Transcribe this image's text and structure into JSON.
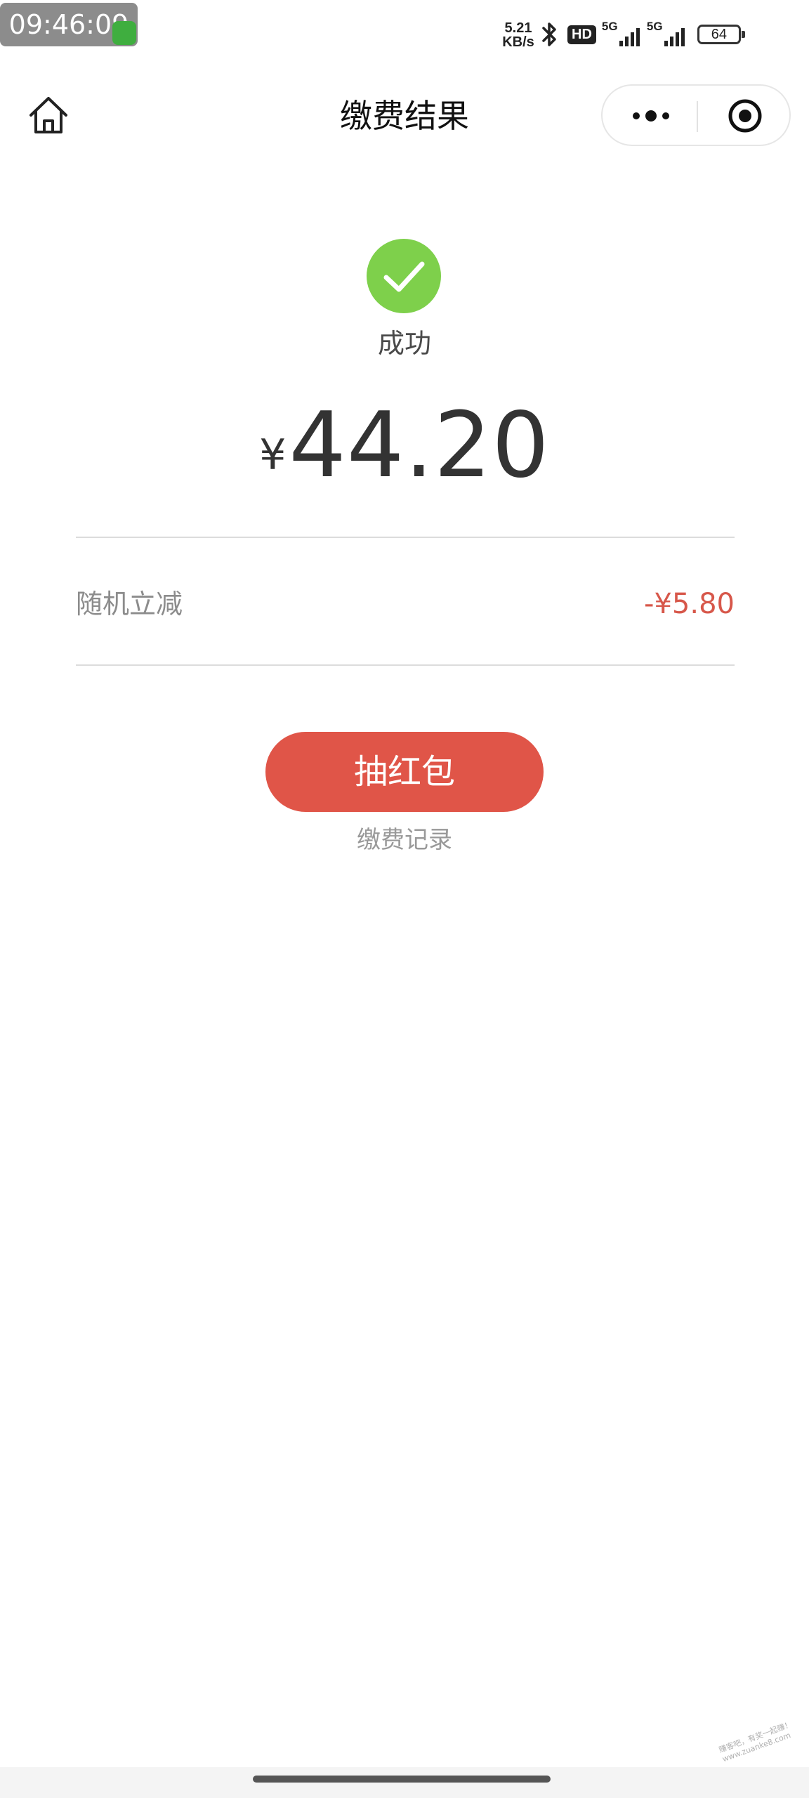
{
  "status_bar": {
    "time": "09:46:09",
    "net_speed_value": "5.21",
    "net_speed_unit": "KB/s",
    "hd_label": "HD",
    "signal_1_label": "5G",
    "signal_2_label": "5G",
    "battery": "64"
  },
  "nav": {
    "title": "缴费结果"
  },
  "result": {
    "status": "成功",
    "currency": "¥",
    "amount": "44.20",
    "discount_label": "随机立减",
    "discount_value": "-¥5.80",
    "primary_button": "抽红包",
    "records_link": "缴费记录"
  },
  "watermark": {
    "line1": "赚客吧，有奖一起赚！",
    "line2": "www.zuanke8.com"
  },
  "colors": {
    "success_green": "#7ed04b",
    "button_red": "#e05548",
    "discount_red": "#d7574a"
  }
}
